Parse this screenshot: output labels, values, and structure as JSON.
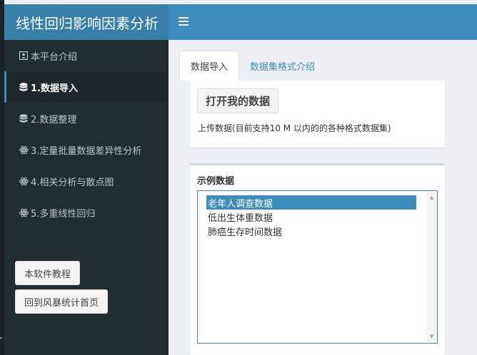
{
  "header": {
    "title": "线性回归影响因素分析",
    "menu_icon": "hamburger-icon"
  },
  "sidebar": {
    "items": [
      {
        "label": "本平台介绍",
        "icon": "id-card-icon"
      },
      {
        "label": "1.数据导入",
        "icon": "database-icon"
      },
      {
        "label": "2.数据整理",
        "icon": "database-icon"
      },
      {
        "label": "3.定量批量数据差异性分析",
        "icon": "atom-icon"
      },
      {
        "label": "4.相关分析与散点图",
        "icon": "atom-icon"
      },
      {
        "label": "5.多重线性回归",
        "icon": "atom-icon"
      }
    ],
    "buttons": {
      "tutorial": "本软件教程",
      "home": "回到风暴统计首页"
    }
  },
  "tabs": [
    {
      "label": "数据导入"
    },
    {
      "label": "数据集格式介绍"
    }
  ],
  "upload": {
    "button_label": "打开我的数据",
    "hint": "上传数据(目前支持10 M 以内的的各种格式数据集)"
  },
  "examples": {
    "label": "示例数据",
    "options": [
      "老年人调查数据",
      "低出生体重数据",
      "肺癌生存时间数据"
    ],
    "selected": "老年人调查数据"
  },
  "colors": {
    "header_dark": "#367fa9",
    "header": "#3c8dbc",
    "sidebar": "#222d32",
    "content_bg": "#ecf0f5"
  }
}
